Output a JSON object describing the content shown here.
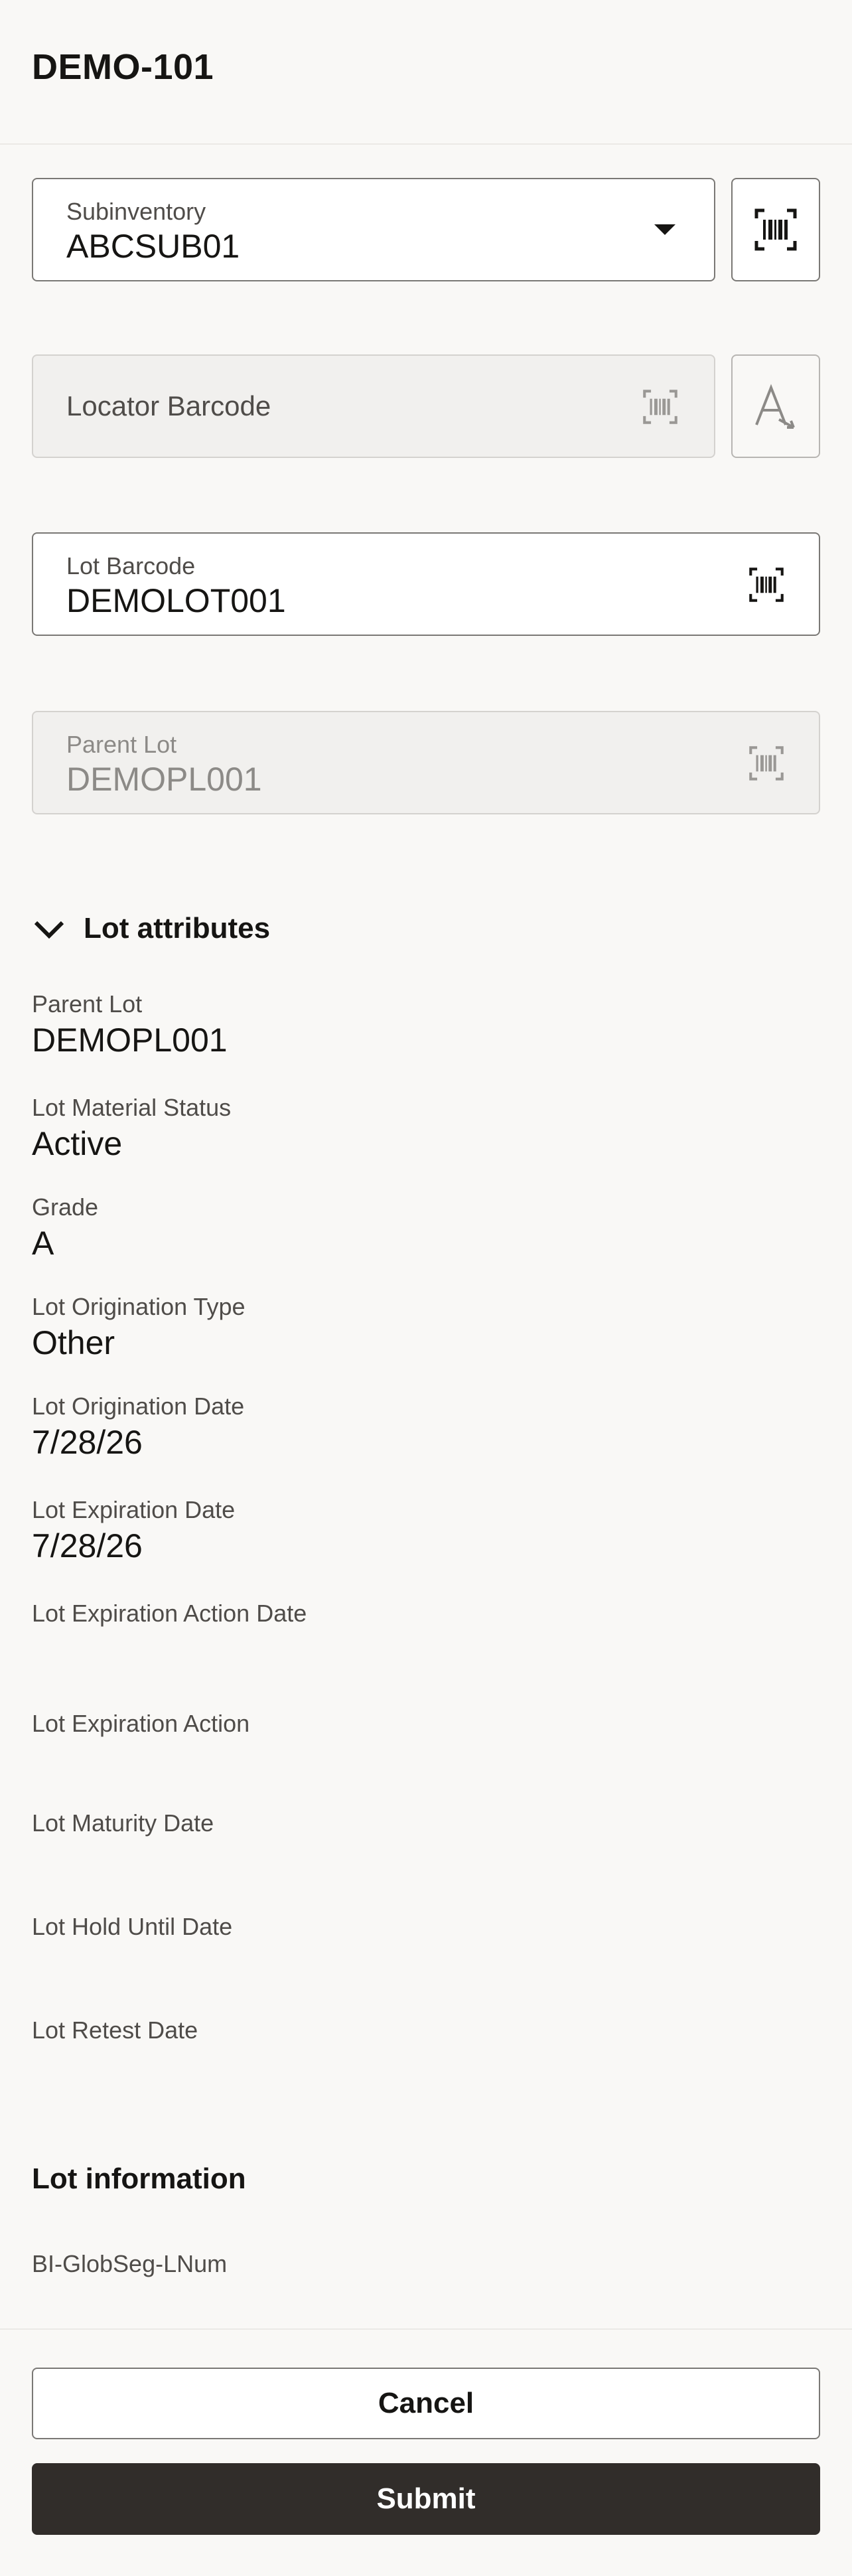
{
  "header": {
    "title": "DEMO-101"
  },
  "subinventory": {
    "label": "Subinventory",
    "value": "ABCSUB01"
  },
  "locator": {
    "placeholder": "Locator Barcode"
  },
  "lot_barcode": {
    "label": "Lot Barcode",
    "value": "DEMOLOT001"
  },
  "parent_lot_field": {
    "label": "Parent Lot",
    "value": "DEMOPL001"
  },
  "lot_attributes": {
    "title": "Lot attributes",
    "items": [
      {
        "label": "Parent Lot",
        "value": "DEMOPL001"
      },
      {
        "label": "Lot Material Status",
        "value": "Active"
      },
      {
        "label": "Grade",
        "value": "A"
      },
      {
        "label": "Lot Origination Type",
        "value": "Other"
      },
      {
        "label": "Lot Origination Date",
        "value": "7/28/26"
      },
      {
        "label": "Lot Expiration Date",
        "value": "7/28/26"
      },
      {
        "label": "Lot Expiration Action Date",
        "value": ""
      },
      {
        "label": "Lot Expiration Action",
        "value": ""
      },
      {
        "label": "Lot Maturity Date",
        "value": ""
      },
      {
        "label": "Lot Hold Until Date",
        "value": ""
      },
      {
        "label": "Lot Retest Date",
        "value": ""
      }
    ]
  },
  "lot_information": {
    "title": "Lot information",
    "items": [
      {
        "label": "BI-GlobSeg-LNum"
      }
    ]
  },
  "footer": {
    "cancel_label": "Cancel",
    "submit_label": "Submit"
  },
  "icons": {
    "dropdown": "chevron-down-icon",
    "barcode": "barcode-scan-icon",
    "manual_entry": "manual-entry-icon",
    "collapse": "chevron-down-icon"
  },
  "colors": {
    "primary_button": "#312d2a",
    "background": "#f9f8f6"
  }
}
